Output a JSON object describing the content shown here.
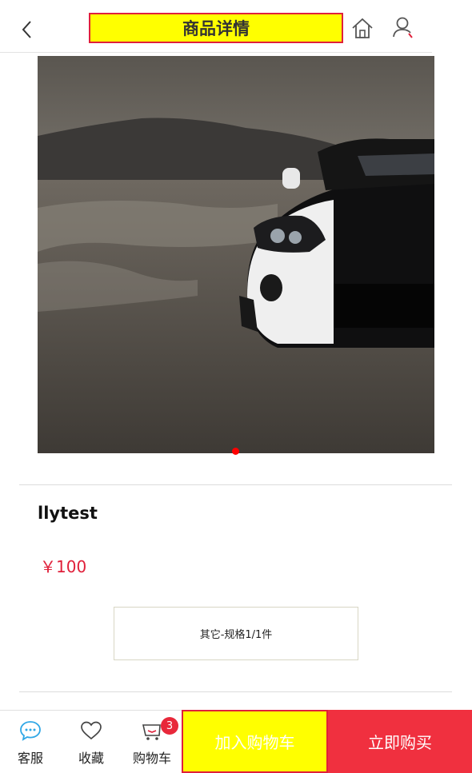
{
  "header": {
    "title": "商品详情",
    "back_icon": "chevron-left-icon",
    "home_icon": "home-icon",
    "user_icon": "user-icon"
  },
  "product": {
    "image": "sports-car-photo",
    "carousel": {
      "total": 1,
      "active": 1
    },
    "name": "llytest",
    "price": "￥100",
    "spec": "其它-规格1/1件"
  },
  "bottom_bar": {
    "service_label": "客服",
    "favorite_label": "收藏",
    "cart_label": "购物车",
    "cart_count": "3",
    "add_to_cart_label": "加入购物车",
    "buy_now_label": "立即购买"
  },
  "colors": {
    "accent_red": "#e0203a",
    "highlight_yellow": "#ffff00",
    "service_blue": "#2fa7e6"
  }
}
